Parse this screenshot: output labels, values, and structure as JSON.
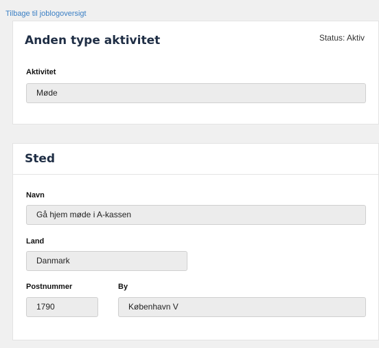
{
  "nav": {
    "back_link": "Tilbage til joblogoversigt"
  },
  "activity_card": {
    "title": "Anden type aktivitet",
    "status": "Status: Aktiv",
    "activity_label": "Aktivitet",
    "activity_value": "Møde"
  },
  "location_card": {
    "title": "Sted",
    "name_label": "Navn",
    "name_value": "Gå hjem møde i A-kassen",
    "country_label": "Land",
    "country_value": "Danmark",
    "postcode_label": "Postnummer",
    "postcode_value": "1790",
    "city_label": "By",
    "city_value": "København V"
  },
  "colors": {
    "link": "#3a7fc4",
    "title": "#1f2e45",
    "field_bg": "#ececec"
  }
}
